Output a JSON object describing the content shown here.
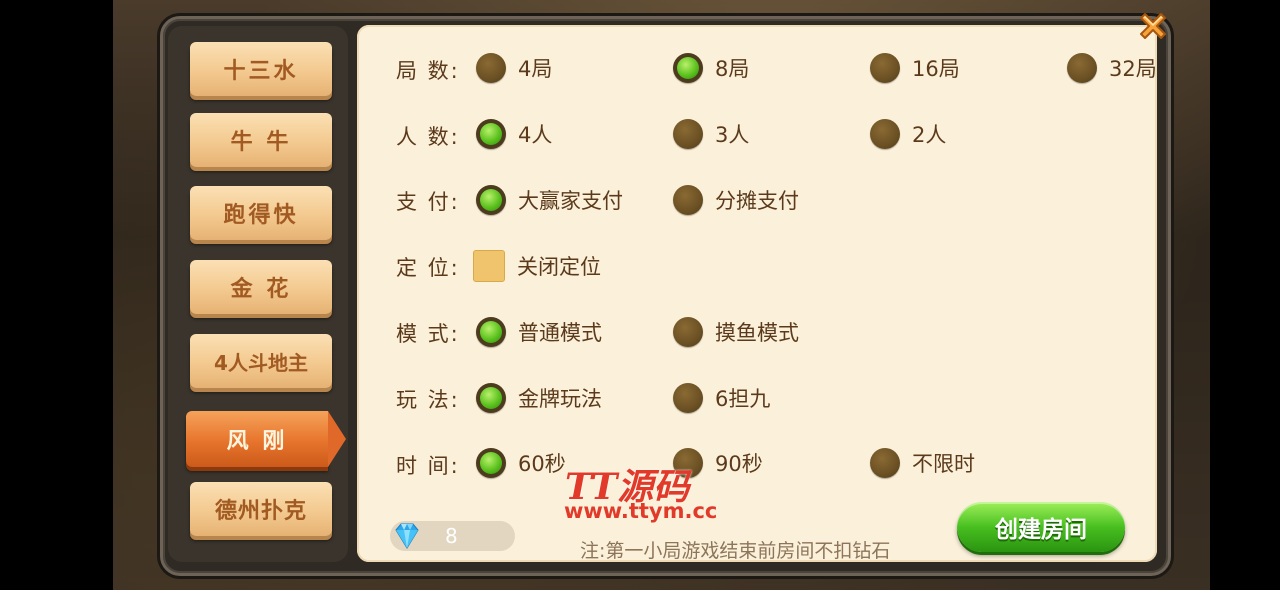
{
  "sidebar": {
    "tabs": [
      {
        "label": "十三水"
      },
      {
        "label": "牛 牛"
      },
      {
        "label": "跑得快"
      },
      {
        "label": "金 花"
      },
      {
        "label": "4人斗地主"
      },
      {
        "label": "风 刚",
        "active": true
      },
      {
        "label": "德州扑克"
      }
    ]
  },
  "settings": {
    "rounds": {
      "label": "局 数:",
      "options": [
        {
          "label": "4局",
          "selected": false
        },
        {
          "label": "8局",
          "selected": true
        },
        {
          "label": "16局",
          "selected": false
        },
        {
          "label": "32局",
          "selected": false
        }
      ]
    },
    "players": {
      "label": "人 数:",
      "options": [
        {
          "label": "4人",
          "selected": true
        },
        {
          "label": "3人",
          "selected": false
        },
        {
          "label": "2人",
          "selected": false
        }
      ]
    },
    "payment": {
      "label": "支 付:",
      "options": [
        {
          "label": "大赢家支付",
          "selected": true
        },
        {
          "label": "分摊支付",
          "selected": false
        }
      ]
    },
    "location": {
      "label": "定 位:",
      "checkbox": {
        "label": "关闭定位",
        "checked": false
      }
    },
    "mode": {
      "label": "模 式:",
      "options": [
        {
          "label": "普通模式",
          "selected": true
        },
        {
          "label": "摸鱼模式",
          "selected": false
        }
      ]
    },
    "play": {
      "label": "玩 法:",
      "options": [
        {
          "label": "金牌玩法",
          "selected": true
        },
        {
          "label": "6担九",
          "selected": false
        }
      ]
    },
    "time": {
      "label": "时 间:",
      "options": [
        {
          "label": "60秒",
          "selected": true
        },
        {
          "label": "90秒",
          "selected": false
        },
        {
          "label": "不限时",
          "selected": false
        }
      ]
    }
  },
  "footer": {
    "diamonds": "8",
    "note": "注:第一小局游戏结束前房间不扣钻石",
    "create_label": "创建房间"
  },
  "watermark": {
    "line1": "TT源码",
    "line2": "www.ttym.cc"
  },
  "colors": {
    "accent_green": "#48bf20",
    "tab_orange": "#e7742c",
    "panel_bg": "#fbf0da"
  }
}
